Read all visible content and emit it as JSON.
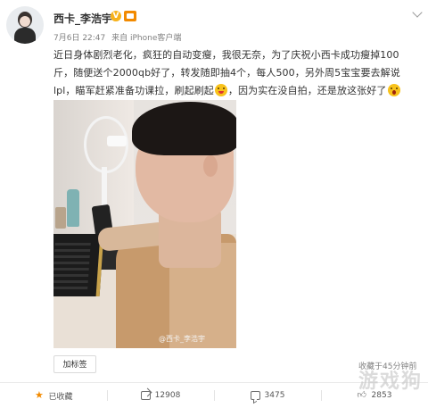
{
  "author": {
    "name": "西卡_李浩宇",
    "verified_badge": "V"
  },
  "meta": {
    "date": "7月6日 22:47",
    "source": "来自 iPhone客户端"
  },
  "post": {
    "lines": [
      "近日身体剧烈老化，疯狂的自动变瘦，我很无奈，为了庆祝小西卡成功瘦掉100",
      "斤，随便送个2000qb好了，转发随即抽4个，每人500，另外周5宝宝要去解说",
      "lpl，瞄军赶紧准备功课拉，刷起刷起",
      "，因为实在没自拍，还是放这张好了"
    ]
  },
  "photo": {
    "watermark": "@西卡_李浩宇"
  },
  "tag_button": "加标签",
  "collected_text": "收藏于45分钟前",
  "toolbar": {
    "favorite": "已收藏",
    "share": "12908",
    "comment": "3475",
    "like": "2853"
  },
  "brand_watermark": "游戏狗",
  "colors": {
    "accent": "#f28a00",
    "verified": "#f7b21b"
  }
}
